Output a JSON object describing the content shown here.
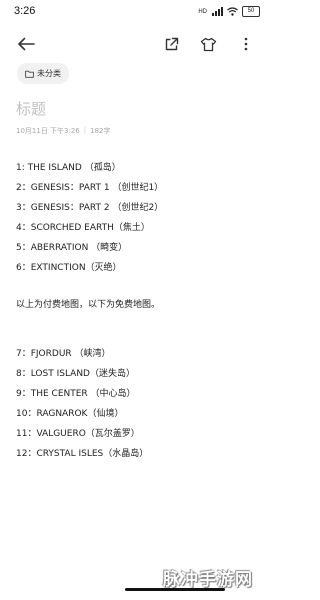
{
  "status_bar": {
    "time": "3:26",
    "signal_label": "HD",
    "battery": "50"
  },
  "toolbar": {
    "back_icon": "arrow-left-icon",
    "share_icon": "share-out-icon",
    "theme_icon": "shirt-icon",
    "more_icon": "more-vertical-icon"
  },
  "folder": {
    "label": "未分类",
    "icon": "folder-icon"
  },
  "note": {
    "title_placeholder": "标题",
    "date": "10月11日 下午3:26",
    "separator": "|",
    "char_count": "182字",
    "lines": [
      "1: THE ISLAND （孤岛）",
      "2：GENESIS：PART 1 （创世纪1）",
      "3：GENESIS：PART 2 （创世纪2）",
      "4：SCORCHED EARTH（焦土）",
      "5：ABERRATION （畸变）",
      "6：EXTINCTION（灭绝）",
      "以上为付费地图，以下为免费地图。",
      "7：FJORDUR （峡湾）",
      "8：LOST ISLAND（迷失岛）",
      "9：THE CENTER （中心岛）",
      "10：RAGNAROK（仙境）",
      "11：VALGUERO（瓦尔盖罗）",
      "12：CRYSTAL ISLES（水晶岛）"
    ]
  },
  "watermark": "脉冲手游网"
}
